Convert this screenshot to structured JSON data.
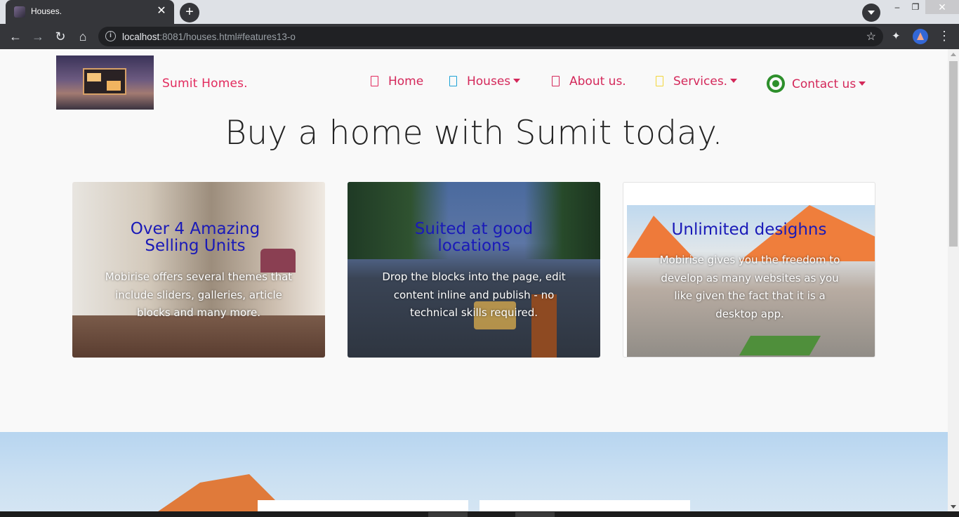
{
  "browser": {
    "tab_title": "Houses.",
    "tab_close": "✕",
    "new_tab": "+",
    "url_host": "localhost",
    "url_rest": ":8081/houses.html#features13-o",
    "window_min": "–",
    "window_max": "❐",
    "window_close": "✕",
    "icons": [
      "back-icon",
      "forward-icon",
      "reload-icon",
      "home-icon",
      "info-icon",
      "star-icon",
      "extensions-icon",
      "profile-avatar",
      "menu-icon"
    ]
  },
  "site": {
    "brand": "Sumit Homes.",
    "nav": [
      {
        "label": "Home",
        "icon_color": "#e22a5d"
      },
      {
        "label": "Houses",
        "icon_color": "#1ea2d6",
        "dropdown": true
      },
      {
        "label": "About us.",
        "icon_color": "#d4285a"
      },
      {
        "label": "Services.",
        "icon_color": "#f3d63a",
        "dropdown": true
      },
      {
        "label": "Contact us",
        "icon": "whatsapp-icon",
        "dropdown": true
      }
    ],
    "heading": "Buy a home with Sumit today.",
    "cards": [
      {
        "title": "Over 4 Amazing Selling Units",
        "text": "Mobirise offers several themes that include sliders, galleries, article blocks and many more."
      },
      {
        "title": "Suited at good locations",
        "text": "Drop the blocks into the page, edit content inline and publish - no technical skills required."
      },
      {
        "title": "Unlimited desighns",
        "text": "Mobirise gives you the freedom to develop as many websites as you like given the fact that it is a desktop app."
      }
    ],
    "colors": {
      "brand": "#e22a5d",
      "card_title": "#1a1ab8",
      "heading": "#232323",
      "whatsapp": "#2d8f2b"
    }
  }
}
